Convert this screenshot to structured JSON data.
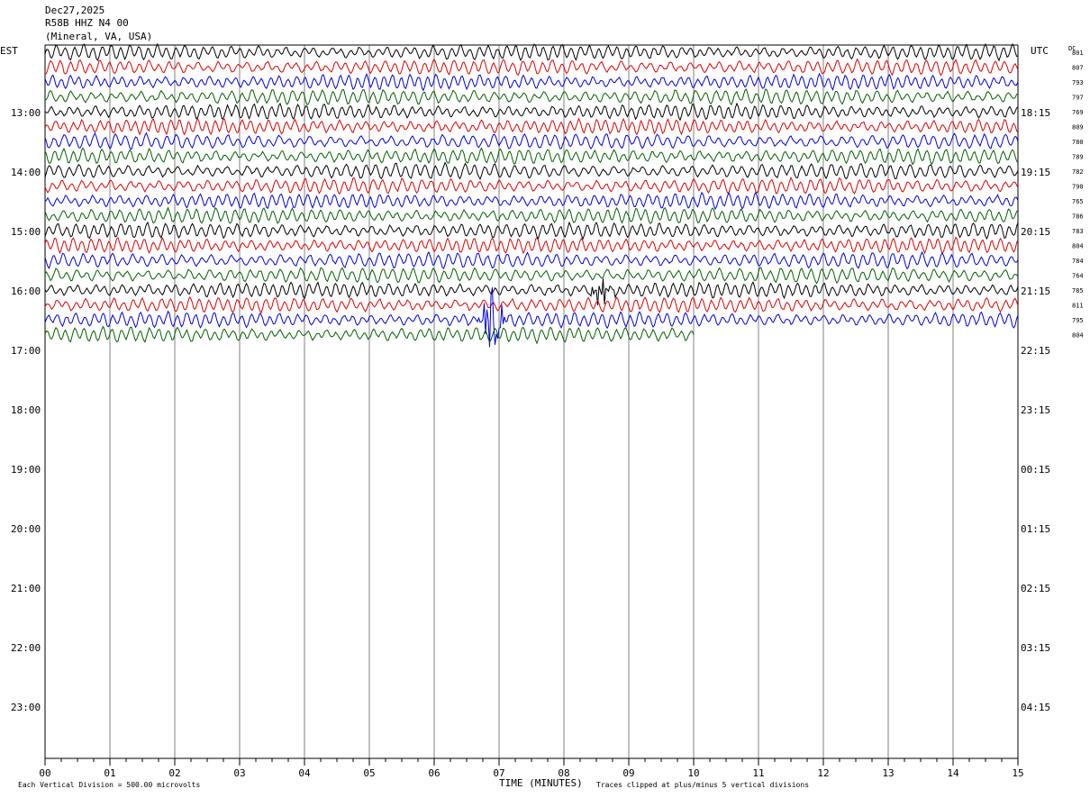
{
  "header": {
    "date": "Dec27,2025",
    "station": "R58B HHZ N4 00",
    "location": "(Mineral, VA, USA)"
  },
  "labels": {
    "left_zone": "EST",
    "right_zone": "UTC",
    "dc_header": "DC",
    "xlabel": "TIME (MINUTES)",
    "scale_note": "Each Vertical Division =  500.00 microvolts",
    "clip_note": "Traces clipped at plus/minus 5 vertical divisions"
  },
  "chart_data": {
    "type": "line",
    "title": "R58B HHZ N4 00",
    "xlabel": "TIME (MINUTES)",
    "xlim": [
      0,
      15
    ],
    "x_ticks": [
      "00",
      "01",
      "02",
      "03",
      "04",
      "05",
      "06",
      "07",
      "08",
      "09",
      "10",
      "11",
      "12",
      "13",
      "14",
      "15"
    ],
    "left_hour_labels": [
      "13:00",
      "14:00",
      "15:00",
      "16:00",
      "17:00",
      "18:00",
      "19:00",
      "20:00",
      "21:00",
      "22:00",
      "23:00"
    ],
    "right_hour_labels": [
      "18:15",
      "19:15",
      "20:15",
      "21:15",
      "22:15",
      "23:15",
      "00:15",
      "01:15",
      "02:15",
      "03:15",
      "04:15"
    ],
    "trace_colors": [
      "#000000",
      "#e00000",
      "#0000e0",
      "#006000"
    ],
    "dc_offsets": [
      "801",
      "807",
      "793",
      "797",
      "769",
      "809",
      "780",
      "789",
      "782",
      "790",
      "765",
      "786",
      "783",
      "804",
      "784",
      "764",
      "785",
      "811",
      "795",
      "804"
    ],
    "trace_count": 20,
    "trace_interval_minutes": 15,
    "events": [
      {
        "trace": 18,
        "minute": 6.9,
        "color": "blue",
        "description_value": "large burst"
      },
      {
        "trace": 16,
        "minute": 8.6,
        "color": "black",
        "description_value": "burst"
      }
    ]
  }
}
